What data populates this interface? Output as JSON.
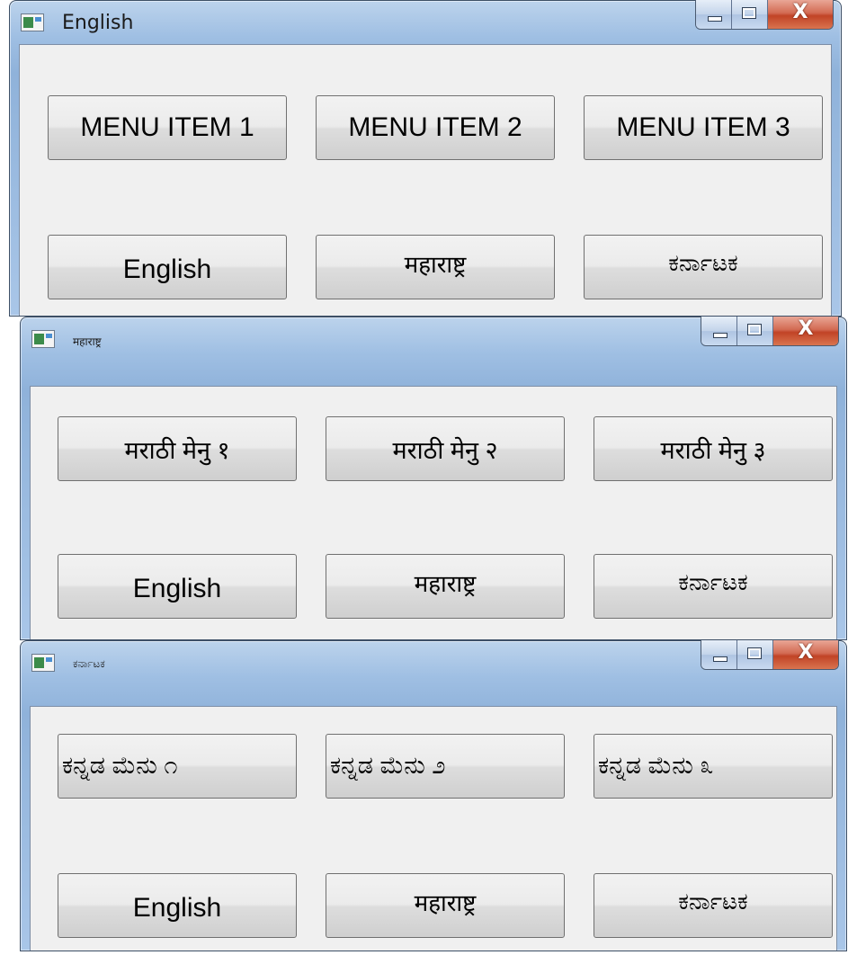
{
  "windows": [
    {
      "title": "English",
      "menu_buttons": [
        "MENU ITEM 1",
        "MENU ITEM 2",
        "MENU ITEM 3"
      ],
      "language_buttons": [
        "English",
        "महाराष्ट्र",
        "ಕರ್ನಾಟಕ"
      ]
    },
    {
      "title": "महाराष्ट्र",
      "menu_buttons": [
        "मराठी मेनु १",
        "मराठी मेनु २",
        "मराठी मेनु ३"
      ],
      "language_buttons": [
        "English",
        "महाराष्ट्र",
        "ಕರ್ನಾಟಕ"
      ]
    },
    {
      "title": "ಕರ್ನಾಟಕ",
      "menu_buttons": [
        "ಕನ್ನಡ ಮೆನು ೧",
        "ಕನ್ನಡ ಮೆನು ೨",
        "ಕನ್ನಡ ಮೆನು ೩"
      ],
      "language_buttons": [
        "English",
        "महाराष्ट्र",
        "ಕರ್ನಾಟಕ"
      ]
    }
  ],
  "caption_buttons": {
    "close_glyph": "X"
  },
  "icons": [
    "app-icon",
    "minimize-icon",
    "maximize-icon",
    "close-icon"
  ]
}
